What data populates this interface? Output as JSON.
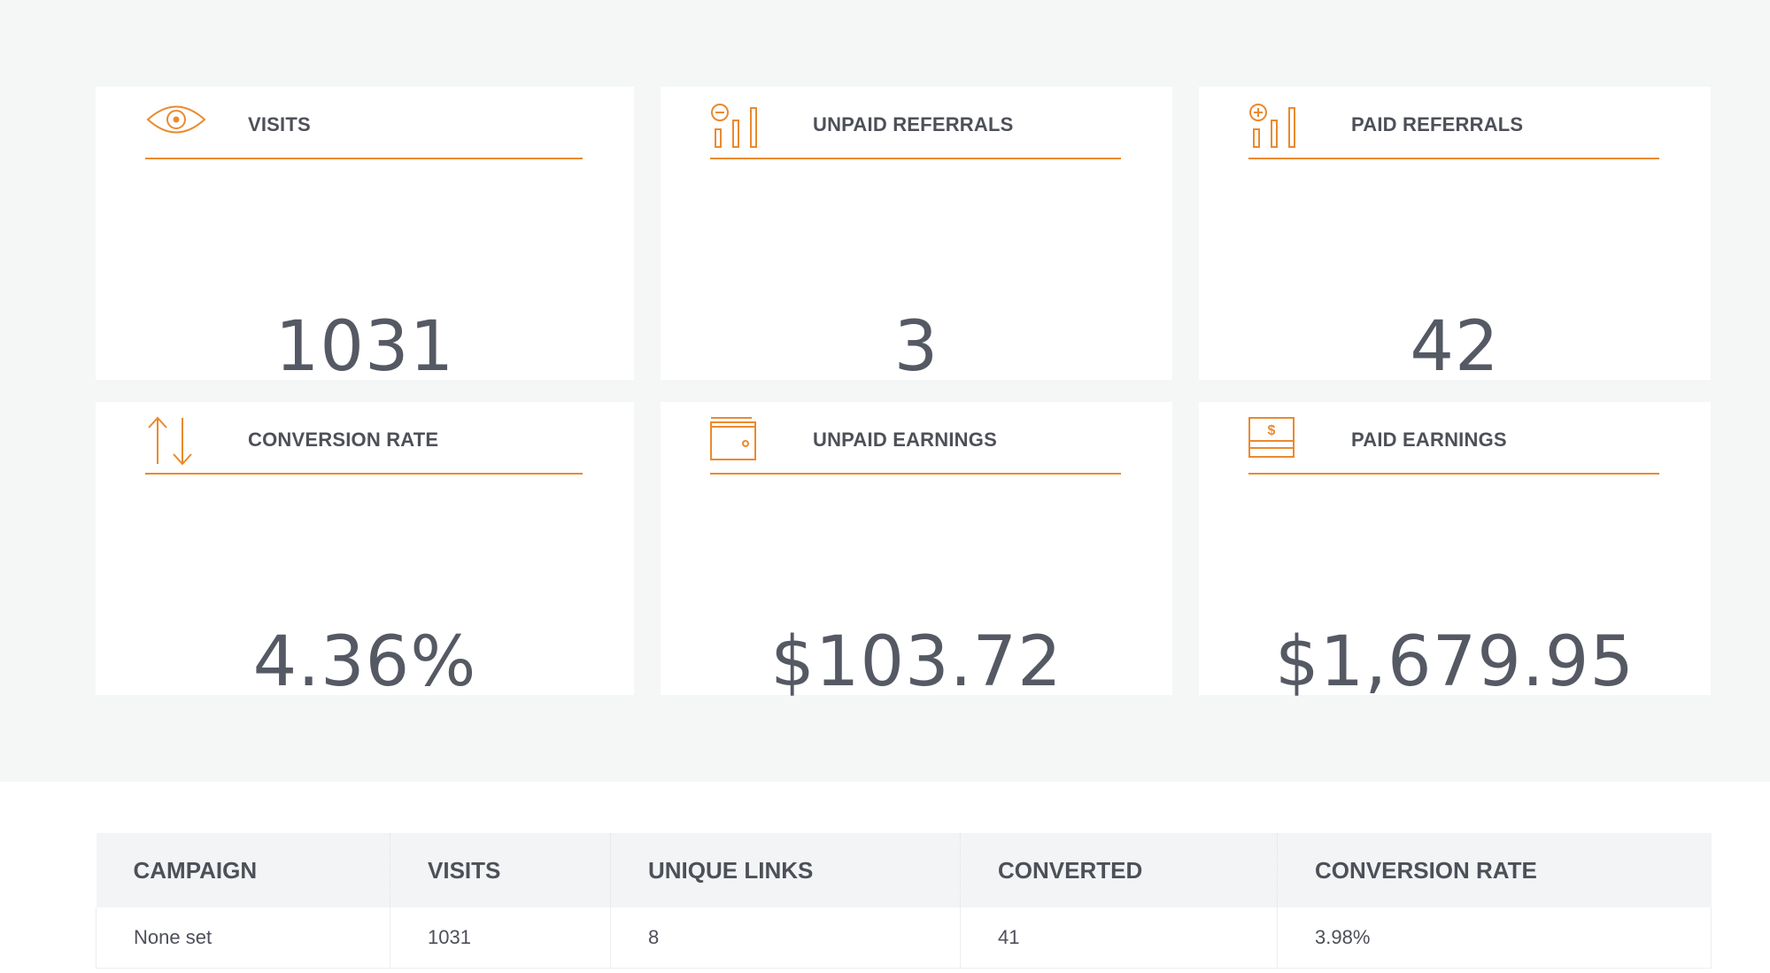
{
  "stats": [
    {
      "title": "VISITS",
      "value": "1031",
      "icon": "eye-icon"
    },
    {
      "title": "UNPAID REFERRALS",
      "value": "3",
      "icon": "bar-chart-minus-icon"
    },
    {
      "title": "PAID REFERRALS",
      "value": "42",
      "icon": "bar-chart-plus-icon"
    },
    {
      "title": "CONVERSION RATE",
      "value": "4.36%",
      "icon": "up-down-arrows-icon"
    },
    {
      "title": "UNPAID EARNINGS",
      "value": "$103.72",
      "icon": "wallet-icon"
    },
    {
      "title": "PAID EARNINGS",
      "value": "$1,679.95",
      "icon": "cash-icon"
    }
  ],
  "colors": {
    "accent": "#ea8a2f",
    "text": "#4d5058",
    "background": "#f5f6f6"
  },
  "table": {
    "headers": [
      "CAMPAIGN",
      "VISITS",
      "UNIQUE LINKS",
      "CONVERTED",
      "CONVERSION RATE"
    ],
    "rows": [
      [
        "None set",
        "1031",
        "8",
        "41",
        "3.98%"
      ]
    ]
  }
}
